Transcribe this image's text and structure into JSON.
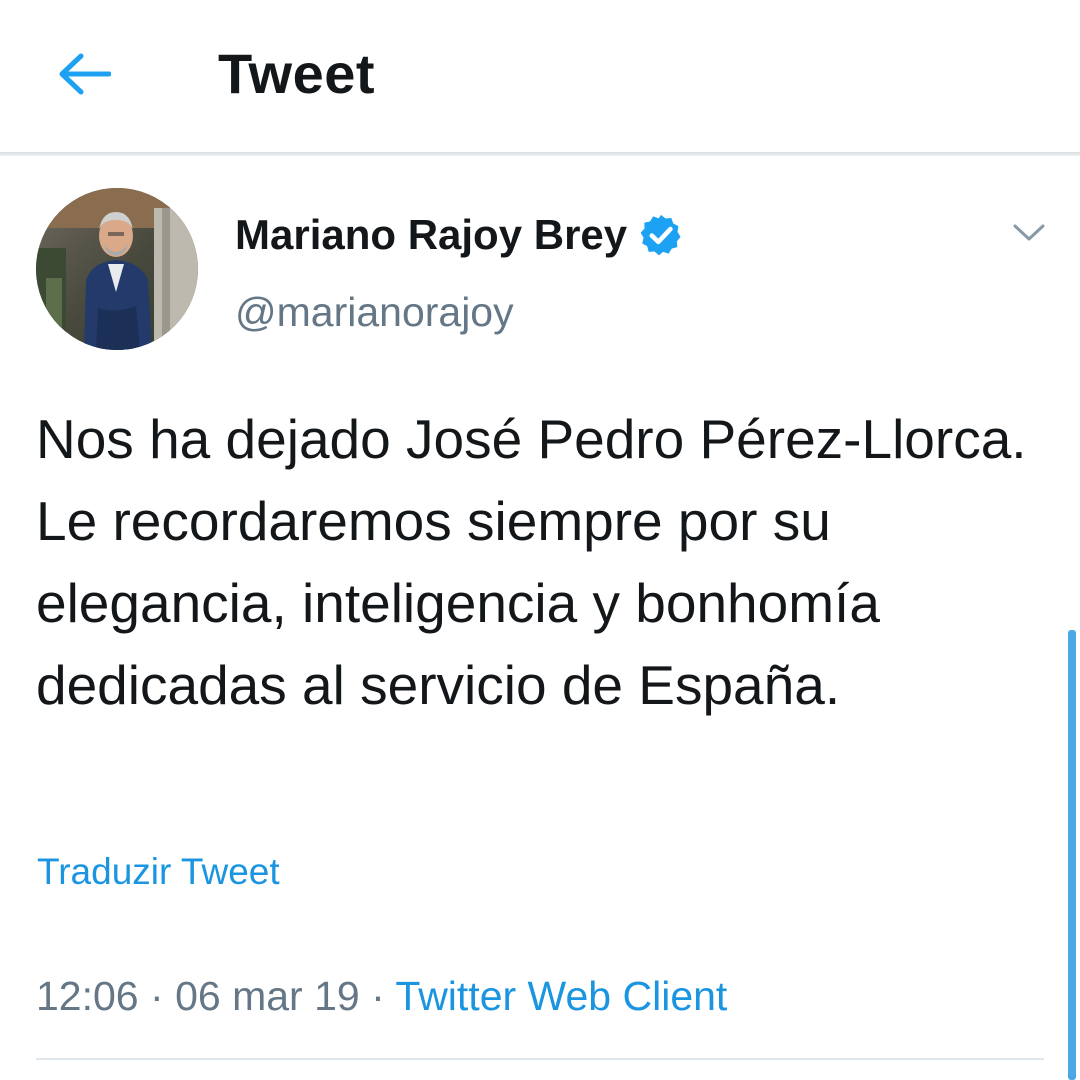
{
  "header": {
    "back_icon": "arrow-left-icon",
    "title": "Tweet"
  },
  "author": {
    "name": "Mariano Rajoy Brey",
    "handle": "@marianorajoy",
    "verified_icon": "verified-badge-icon",
    "avatar_icon": "avatar-photo",
    "more_icon": "chevron-down-icon"
  },
  "tweet": {
    "text": "Nos ha dejado José Pedro Pérez-Llorca. Le recordaremos siempre por su elegancia, inteligencia y bonhomía dedicadas al servicio de España.",
    "translate_label": "Traduzir Tweet",
    "time": "12:06",
    "date": "06 mar 19",
    "separator": "·",
    "source": "Twitter Web Client"
  },
  "colors": {
    "accent": "#1da1f2",
    "link": "#1b95e0",
    "text": "#14171a",
    "secondary": "#657786"
  }
}
